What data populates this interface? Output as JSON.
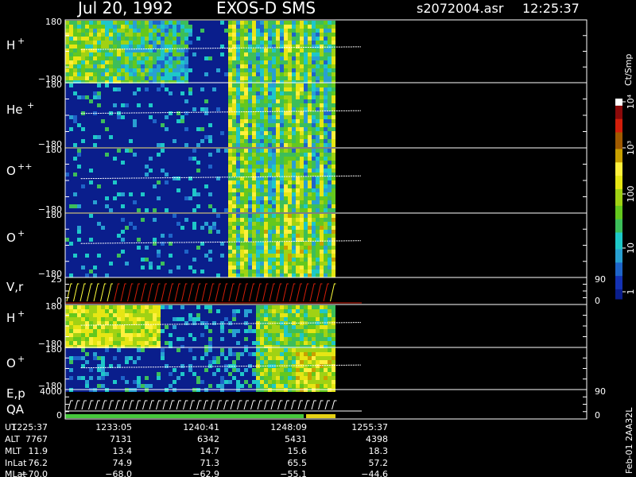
{
  "header": {
    "date": "Jul 20, 1992",
    "instrument": "EXOS-D SMS",
    "file": "s2072004.asr",
    "time": "12:25:37"
  },
  "colorbar": {
    "unit_label": "Ct/Smp",
    "tick_labels": [
      "1",
      "10",
      "100",
      "10³",
      "10⁴"
    ]
  },
  "side_label": "Feb-01 2AA32L",
  "colors": {
    "background": "#000000",
    "axis": "#ffffff",
    "low": "#0a1e8c",
    "trace": "#ffffff",
    "red_trace": "#d21e0a",
    "yellow_trace": "#ffff3c"
  },
  "chart_data": [
    {
      "type": "heatmap",
      "panel": "H+ (pitch angle)",
      "label": "H",
      "label_sup": "+",
      "y_tick_labels": [
        "180",
        "−180"
      ],
      "ylim": [
        -180,
        180
      ]
    },
    {
      "type": "heatmap",
      "panel": "He+ (pitch angle)",
      "label": "He",
      "label_sup": "+",
      "y_tick_labels": [
        "180",
        "−180"
      ],
      "ylim": [
        -180,
        180
      ]
    },
    {
      "type": "heatmap",
      "panel": "O++ (pitch angle)",
      "label": "O",
      "label_sup": "++",
      "y_tick_labels": [
        "180",
        "−180"
      ],
      "ylim": [
        -180,
        180
      ]
    },
    {
      "type": "heatmap",
      "panel": "O+ (pitch angle)",
      "label": "O",
      "label_sup": "+",
      "y_tick_labels": [
        "180",
        "−180"
      ],
      "ylim": [
        -180,
        180
      ]
    },
    {
      "type": "line",
      "panel": "V,r",
      "label": "V,r",
      "y_tick_labels": [
        "25",
        "0"
      ],
      "right_tick_labels": [
        "90",
        "0"
      ],
      "ylim": [
        0,
        25
      ]
    },
    {
      "type": "heatmap",
      "panel": "H+ (energy)",
      "label": "H",
      "label_sup": "+",
      "y_tick_labels": [
        "180",
        "−180"
      ],
      "ylim": [
        -180,
        180
      ]
    },
    {
      "type": "heatmap",
      "panel": "O+ (energy)",
      "label": "O",
      "label_sup": "+",
      "y_tick_labels": [
        "180",
        "−180"
      ],
      "ylim": [
        -180,
        180
      ]
    },
    {
      "type": "line",
      "panel": "E,p QA",
      "label": "E,p",
      "label2": "QA",
      "y_tick_labels": [
        "4000",
        "0"
      ],
      "right_tick_labels": [
        "90",
        "0"
      ],
      "ylim": [
        0,
        4000
      ]
    }
  ],
  "ephemeris": {
    "row_labels": [
      "UT",
      "ALT",
      "MLT",
      "InLat",
      "MLat"
    ],
    "columns": [
      [
        "1225:37",
        "7767",
        "11.9",
        "76.2",
        "−70.0"
      ],
      [
        "1233:05",
        "7131",
        "13.4",
        "74.9",
        "−68.0"
      ],
      [
        "1240:41",
        "6342",
        "14.7",
        "71.3",
        "−62.9"
      ],
      [
        "1248:09",
        "5431",
        "15.6",
        "65.5",
        "−55.1"
      ],
      [
        "1255:37",
        "4398",
        "18.3",
        "57.2",
        "−44.6"
      ]
    ]
  }
}
